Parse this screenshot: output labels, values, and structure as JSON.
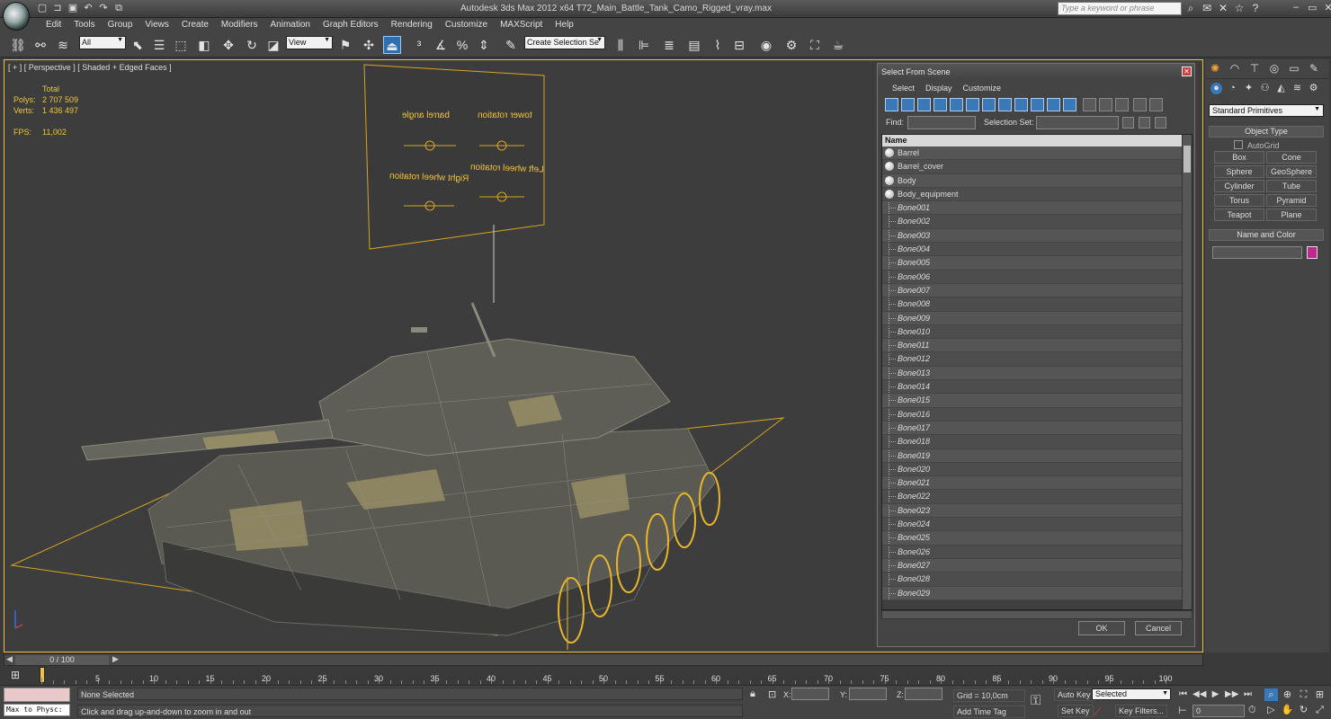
{
  "window": {
    "title": "Autodesk 3ds Max  2012 x64     T72_Main_Battle_Tank_Camo_Rigged_vray.max",
    "search_placeholder": "Type a keyword or phrase"
  },
  "menu": [
    "Edit",
    "Tools",
    "Group",
    "Views",
    "Create",
    "Modifiers",
    "Animation",
    "Graph Editors",
    "Rendering",
    "Customize",
    "MAXScript",
    "Help"
  ],
  "toolbar": {
    "selection_filter": "All",
    "ref_coord": "View",
    "named_selection": "Create Selection Se"
  },
  "viewport": {
    "label": "[ + ] [ Perspective ] [ Shaded + Edged Faces ]",
    "stats_header": "Total",
    "polys_label": "Polys:",
    "polys_value": "2 707 509",
    "verts_label": "Verts:",
    "verts_value": "1 436 497",
    "fps_label": "FPS:",
    "fps_value": "11,002",
    "panel_labels": [
      "tower rotation",
      "barrel angle",
      "Left wheel rotation",
      "Right wheel rotation"
    ]
  },
  "dialog": {
    "title": "Select From Scene",
    "menu": [
      "Select",
      "Display",
      "Customize"
    ],
    "find_label": "Find:",
    "selection_set_label": "Selection Set:",
    "column_name": "Name",
    "objects": [
      "Barrel",
      "Barrel_cover",
      "Body",
      "Body_equipment"
    ],
    "bones": [
      "Bone001",
      "Bone002",
      "Bone003",
      "Bone004",
      "Bone005",
      "Bone006",
      "Bone007",
      "Bone008",
      "Bone009",
      "Bone010",
      "Bone011",
      "Bone012",
      "Bone013",
      "Bone014",
      "Bone015",
      "Bone016",
      "Bone017",
      "Bone018",
      "Bone019",
      "Bone020",
      "Bone021",
      "Bone022",
      "Bone023",
      "Bone024",
      "Bone025",
      "Bone026",
      "Bone027",
      "Bone028",
      "Bone029"
    ],
    "ok_label": "OK",
    "cancel_label": "Cancel"
  },
  "command_panel": {
    "category": "Standard Primitives",
    "object_type_header": "Object Type",
    "autogrid_label": "AutoGrid",
    "primitives": [
      "Box",
      "Cone",
      "Sphere",
      "GeoSphere",
      "Cylinder",
      "Tube",
      "Torus",
      "Pyramid",
      "Teapot",
      "Plane"
    ],
    "name_color_header": "Name and Color",
    "object_color": "#c0288c"
  },
  "timeline": {
    "frame_counter": "0 / 100",
    "ruler_labels": [
      "0",
      "5",
      "10",
      "15",
      "20",
      "25",
      "30",
      "35",
      "40",
      "45",
      "50",
      "55",
      "60",
      "65",
      "70",
      "75",
      "80",
      "85",
      "90",
      "95",
      "100"
    ]
  },
  "status": {
    "maxscript_label": "Max to Physc:",
    "selection_status": "None Selected",
    "prompt": "Click and drag up-and-down to zoom in and out",
    "x_label": "X:",
    "y_label": "Y:",
    "z_label": "Z:",
    "grid": "Grid = 10,0cm",
    "add_time_tag": "Add Time Tag",
    "auto_key": "Auto Key",
    "auto_key_mode": "Selected",
    "set_key": "Set Key",
    "key_filters": "Key Filters...",
    "current_frame": "0"
  }
}
